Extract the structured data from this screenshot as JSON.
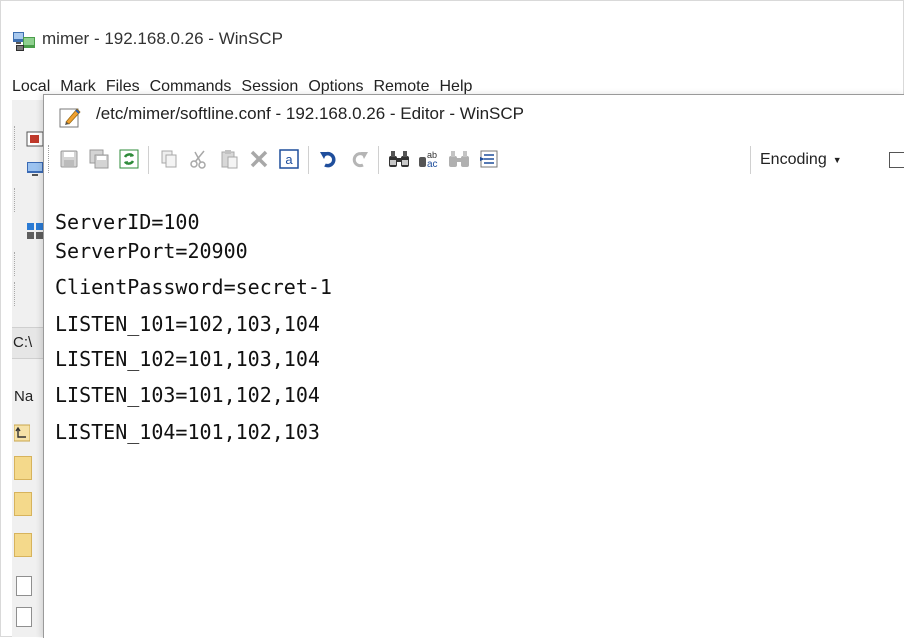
{
  "main_window": {
    "title": "mimer - 192.168.0.26 - WinSCP",
    "menu": [
      "Local",
      "Mark",
      "Files",
      "Commands",
      "Session",
      "Options",
      "Remote",
      "Help"
    ],
    "path_fragment": "C:\\",
    "column_fragment": "Na"
  },
  "editor": {
    "title": "/etc/mimer/softline.conf - 192.168.0.26 - Editor - WinSCP",
    "toolbar": {
      "buttons": [
        {
          "name": "save-icon",
          "label": "Save"
        },
        {
          "name": "save-all-icon",
          "label": "Save All"
        },
        {
          "name": "reload-icon",
          "label": "Reload"
        },
        {
          "name": "copy-icon",
          "label": "Copy"
        },
        {
          "name": "cut-icon",
          "label": "Cut"
        },
        {
          "name": "paste-icon",
          "label": "Paste"
        },
        {
          "name": "delete-icon",
          "label": "Delete"
        },
        {
          "name": "select-all-icon",
          "label": "Select All"
        },
        {
          "name": "undo-icon",
          "label": "Undo"
        },
        {
          "name": "redo-icon",
          "label": "Redo"
        },
        {
          "name": "find-icon",
          "label": "Find"
        },
        {
          "name": "replace-icon",
          "label": "Replace"
        },
        {
          "name": "find-next-icon",
          "label": "Find Next"
        },
        {
          "name": "goto-line-icon",
          "label": "Go to Line"
        }
      ],
      "encoding_label": "Encoding"
    },
    "lines": [
      "ServerID=100",
      "ServerPort=20900",
      "ClientPassword=secret-1",
      "LISTEN_101=102,103,104",
      "LISTEN_102=101,103,104",
      "LISTEN_103=101,102,104",
      "LISTEN_104=101,102,103"
    ]
  },
  "colors": {
    "background": "#ffffff",
    "toolbar_blue": "#1f4e9c",
    "reload_green": "#2e8b3a",
    "edit_pencil": "#f0a030"
  }
}
